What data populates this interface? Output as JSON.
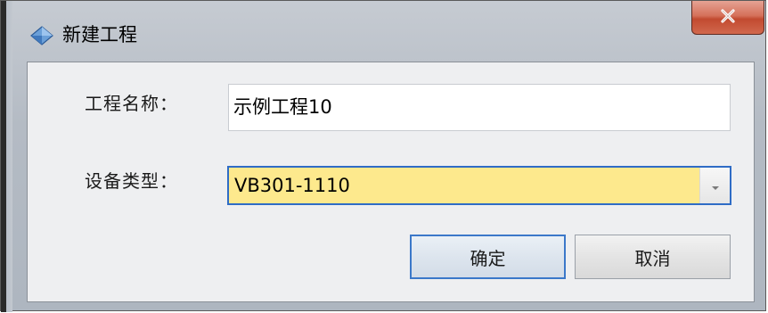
{
  "window": {
    "title": "新建工程",
    "close_symbol": "x",
    "icon": "diamond-app-icon"
  },
  "form": {
    "name_label": "工程名称：",
    "name_value": "示例工程10",
    "type_label": "设备类型：",
    "type_value": "VB301-1110",
    "type_highlight_color": "#fde98d"
  },
  "buttons": {
    "ok_label": "确定",
    "cancel_label": "取消"
  },
  "colors": {
    "focus_border": "#2f6cc6",
    "close_button": "#c24a30"
  }
}
